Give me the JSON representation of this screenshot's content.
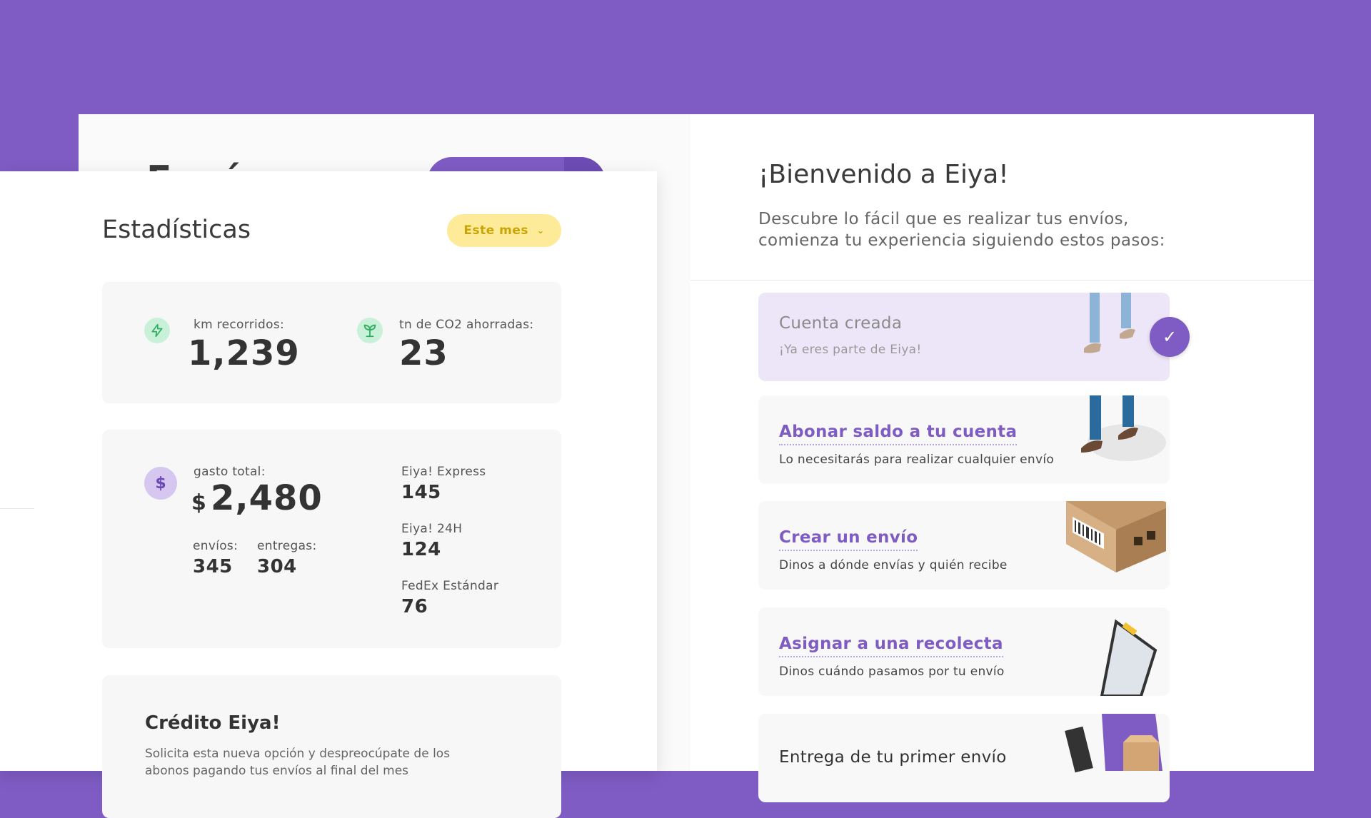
{
  "background_panel": {
    "title_fragment": "Envíos"
  },
  "stats": {
    "title": "Estadísticas",
    "period": "Este mes",
    "km_label": "km recorridos:",
    "km_value": "1,239",
    "co2_label": "tn de CO2 ahorradas:",
    "co2_value": "23",
    "spend_label": "gasto total:",
    "currency": "$",
    "spend_value": "2,480",
    "envios_label": "envíos:",
    "envios_value": "345",
    "entregas_label": "entregas:",
    "entregas_value": "304",
    "services": [
      {
        "name": "Eiya! Express",
        "value": "145"
      },
      {
        "name": "Eiya! 24H",
        "value": "124"
      },
      {
        "name": "FedEx Estándar",
        "value": "76"
      }
    ],
    "credit_title": "Crédito Eiya!",
    "credit_text": "Solicita esta nueva opción y despreocúpate de los abonos pagando tus envíos al final del mes"
  },
  "welcome": {
    "title": "¡Bienvenido a Eiya!",
    "subtitle": "Descubre lo fácil que es realizar tus envíos, comienza tu experiencia siguiendo estos pasos:",
    "steps": [
      {
        "title": "Cuenta creada",
        "desc": "¡Ya eres parte de Eiya!"
      },
      {
        "title": "Abonar saldo a tu cuenta",
        "desc": "Lo necesitarás para realizar cualquier envío"
      },
      {
        "title": "Crear un envío",
        "desc": "Dinos a dónde envías y quién recibe"
      },
      {
        "title": "Asignar a una recolecta",
        "desc": "Dinos cuándo pasamos por tu envío"
      },
      {
        "title": "Entrega de tu primer envío",
        "desc": ""
      }
    ]
  },
  "colors": {
    "brand": "#7e5cc4",
    "pill": "#fdeb9a",
    "done_step": "#ece6f8"
  },
  "icons": [
    "bolt-icon",
    "sprout-icon",
    "dollar-icon",
    "check-icon",
    "chevron-down-icon"
  ]
}
